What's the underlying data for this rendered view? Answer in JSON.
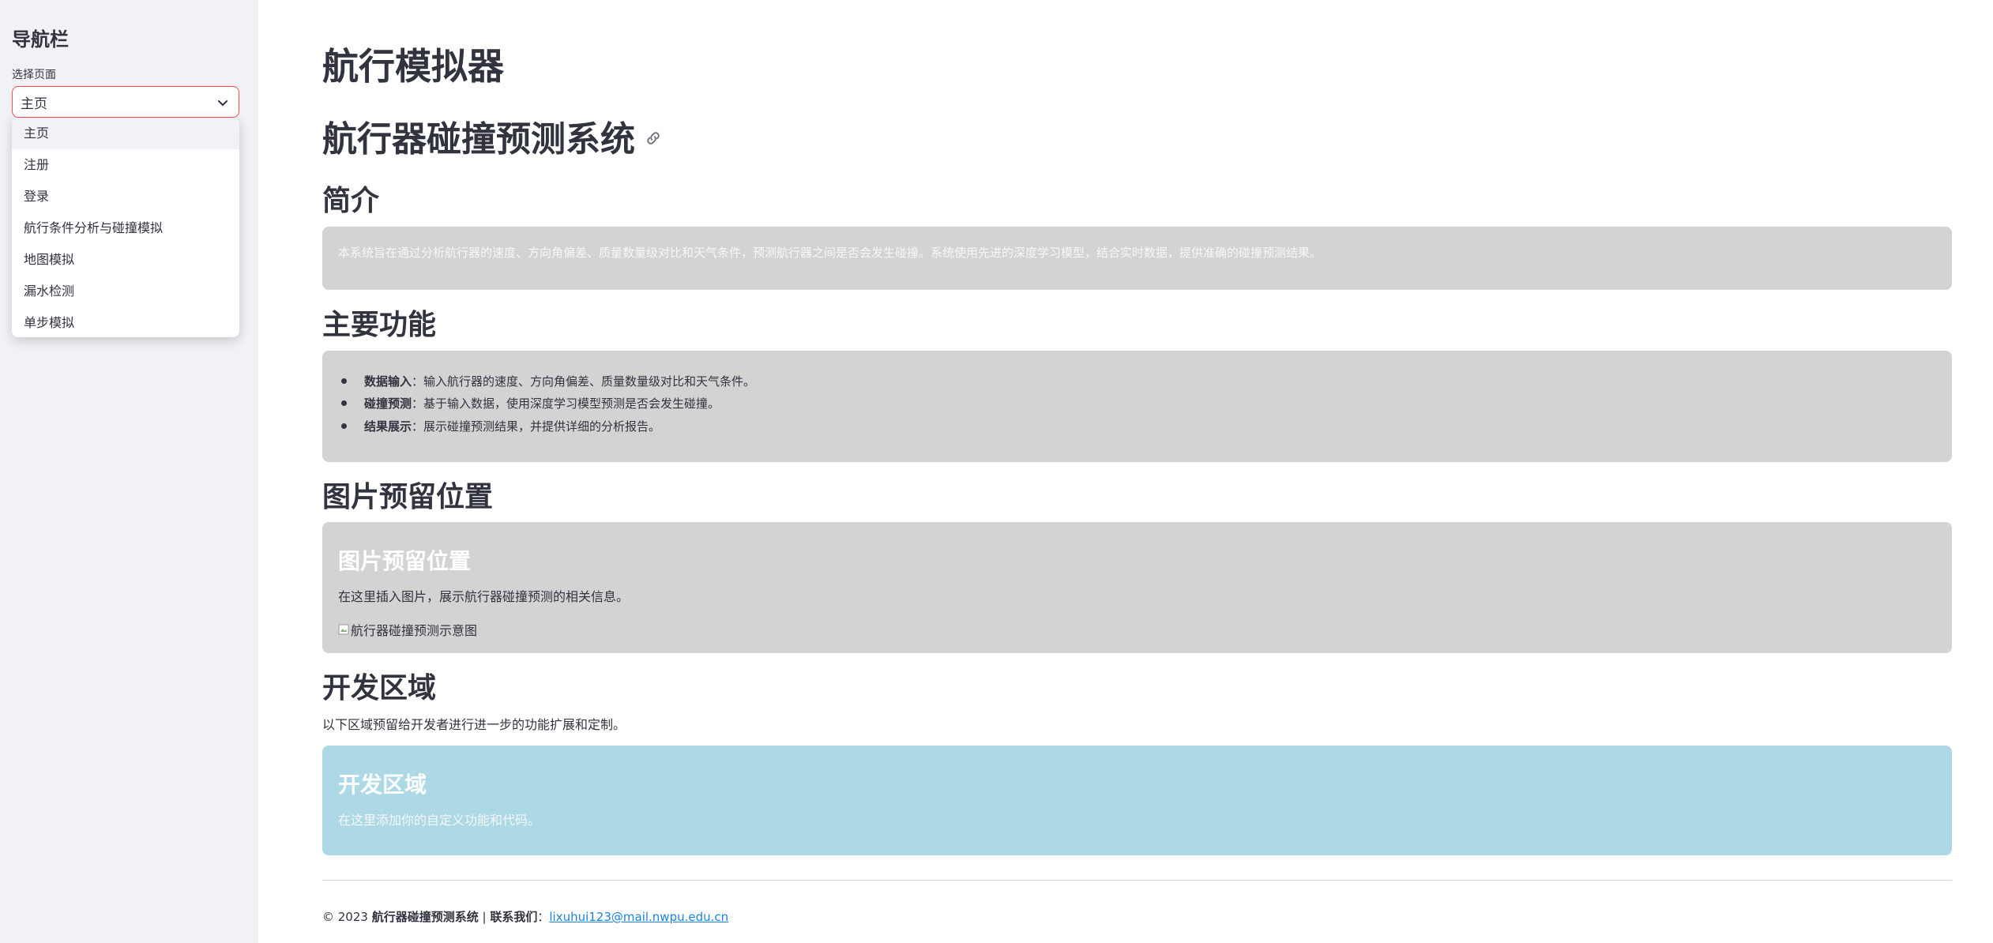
{
  "sidebar": {
    "title": "导航栏",
    "select_label": "选择页面",
    "selected_value": "主页",
    "options": [
      "主页",
      "注册",
      "登录",
      "航行条件分析与碰撞模拟",
      "地图模拟",
      "漏水检测",
      "单步模拟"
    ]
  },
  "main": {
    "title": "航行模拟器",
    "subtitle": "航行器碰撞预测系统",
    "intro": {
      "heading": "简介",
      "text": "本系统旨在通过分析航行器的速度、方向角偏差、质量数量级对比和天气条件，预测航行器之间是否会发生碰撞。系统使用先进的深度学习模型，结合实时数据，提供准确的碰撞预测结果。"
    },
    "features": {
      "heading": "主要功能",
      "items": [
        {
          "label": "数据输入",
          "text": "：输入航行器的速度、方向角偏差、质量数量级对比和天气条件。"
        },
        {
          "label": "碰撞预测",
          "text": "：基于输入数据，使用深度学习模型预测是否会发生碰撞。"
        },
        {
          "label": "结果展示",
          "text": "：展示碰撞预测结果，并提供详细的分析报告。"
        }
      ]
    },
    "image_section": {
      "heading": "图片预留位置",
      "panel_title": "图片预留位置",
      "panel_text": "在这里插入图片，展示航行器碰撞预测的相关信息。",
      "image_alt": "航行器碰撞预测示意图"
    },
    "dev_section": {
      "heading": "开发区域",
      "intro": "以下区域预留给开发者进行进一步的功能扩展和定制。",
      "panel_title": "开发区域",
      "panel_text": "在这里添加你的自定义功能和代码。"
    },
    "footer": {
      "copyright": "© 2023 ",
      "system_name": "航行器碰撞预测系统",
      "separator": " | ",
      "contact_label": "联系我们",
      "colon": "：",
      "email": "lixuhui123@mail.nwpu.edu.cn"
    }
  },
  "colors": {
    "accent": "#ff4b4b",
    "sidebar_bg": "#f0f2f6",
    "panel_gray": "#d3d3d3",
    "panel_blue": "#add8e6",
    "link": "#1c83e1"
  }
}
